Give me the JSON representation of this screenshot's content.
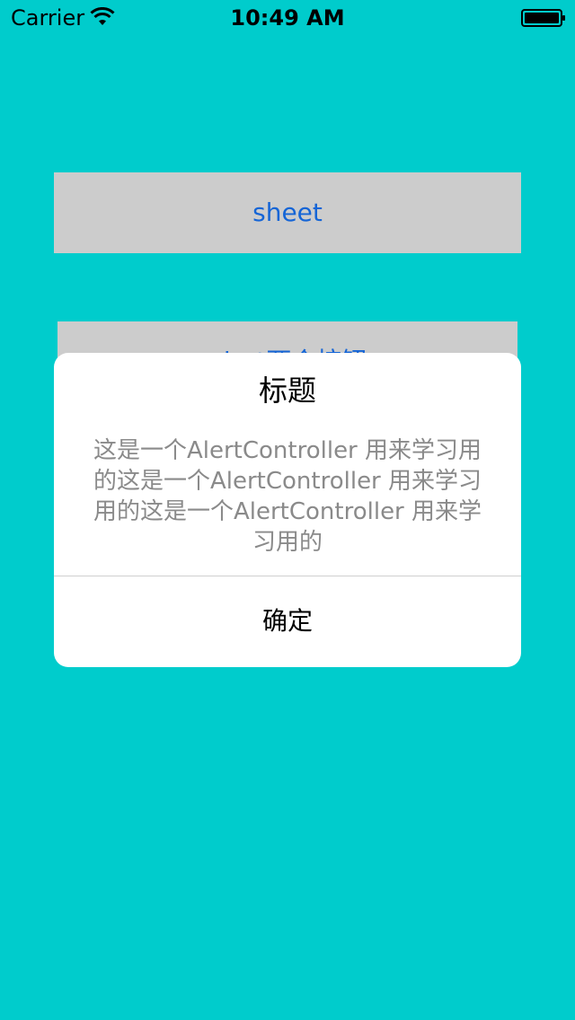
{
  "status_bar": {
    "carrier": "Carrier",
    "time": "10:49 AM",
    "wifi_icon": "wifi-icon",
    "battery_icon": "battery-icon"
  },
  "main": {
    "sheet_button_label": "sheet",
    "second_button_label": "alert两个按钮"
  },
  "alert": {
    "title": "标题",
    "message": "这是一个AlertController 用来学习用的这是一个AlertController 用来学习用的这是一个AlertController 用来学习用的",
    "confirm_label": "确定"
  },
  "colors": {
    "background": "#00CCCC",
    "button_bg": "#CCCCCC",
    "button_text": "#1565D6",
    "alert_bg": "#FFFFFF",
    "message_text": "#8A8A8A"
  }
}
